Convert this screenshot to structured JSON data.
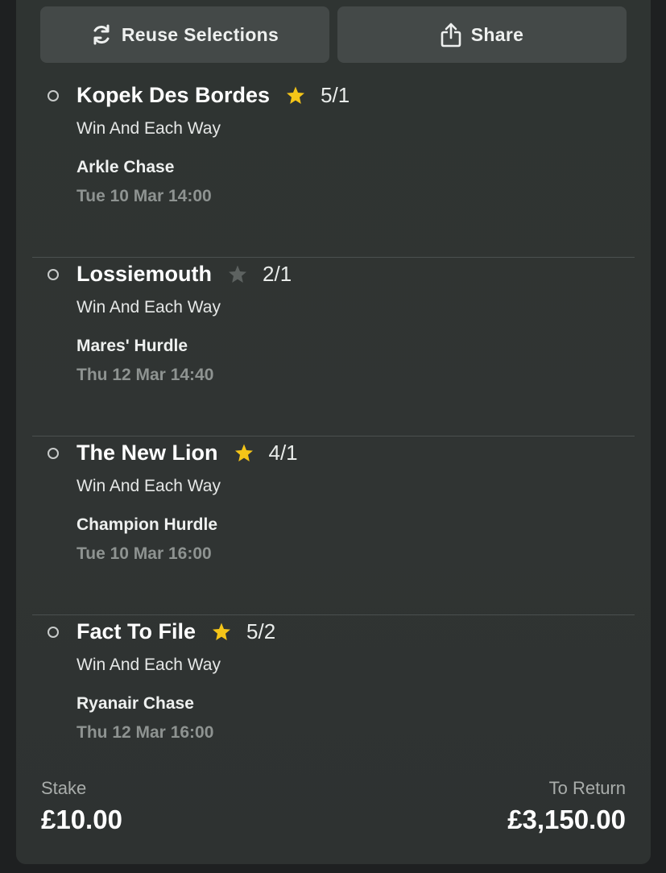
{
  "actions": {
    "reuse_label": "Reuse Selections",
    "reuse_icon": "refresh-icon",
    "share_label": "Share",
    "share_icon": "share-icon"
  },
  "selections": [
    {
      "horse": "Kopek Des Bordes",
      "favourite": true,
      "odds": "5/1",
      "market": "Win And Each Way",
      "race": "Arkle Chase",
      "time": "Tue 10 Mar 14:00"
    },
    {
      "horse": "Lossiemouth",
      "favourite": false,
      "odds": "2/1",
      "market": "Win And Each Way",
      "race": "Mares' Hurdle",
      "time": "Thu 12 Mar 14:40"
    },
    {
      "horse": "The New Lion",
      "favourite": true,
      "odds": "4/1",
      "market": "Win And Each Way",
      "race": "Champion Hurdle",
      "time": "Tue 10 Mar 16:00"
    },
    {
      "horse": "Fact To File",
      "favourite": true,
      "odds": "5/2",
      "market": "Win And Each Way",
      "race": "Ryanair Chase",
      "time": "Thu 12 Mar 16:00"
    }
  ],
  "summary": {
    "stake_label": "Stake",
    "stake_value": "£10.00",
    "return_label": "To Return",
    "return_value": "£3,150.00"
  },
  "colors": {
    "star_active": "#f5c518",
    "star_inactive": "#5d6260",
    "card_bg": "#303433",
    "button_bg": "#444948"
  }
}
